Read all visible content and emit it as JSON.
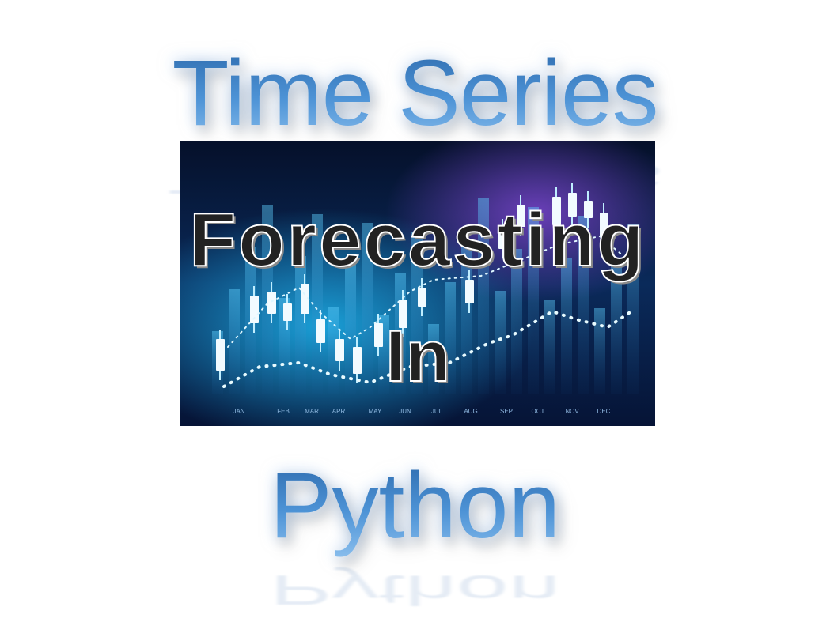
{
  "title_top": "Time Series",
  "overlay_line1": "Forecasting",
  "overlay_line2": "In",
  "title_bottom": "Python",
  "background_image": {
    "month_labels": [
      "JAN",
      "FEB",
      "MAR",
      "APR",
      "MAY",
      "JUN",
      "JUL",
      "AUG",
      "SEP",
      "OCT",
      "NOV",
      "DEC"
    ]
  },
  "colors": {
    "title_blue": "#3f86c9",
    "overlay_text": "#222222",
    "image_bg_dark": "#05102a",
    "image_glow_cyan": "#1aa0d8",
    "image_glow_purple": "#6a3fb8"
  }
}
